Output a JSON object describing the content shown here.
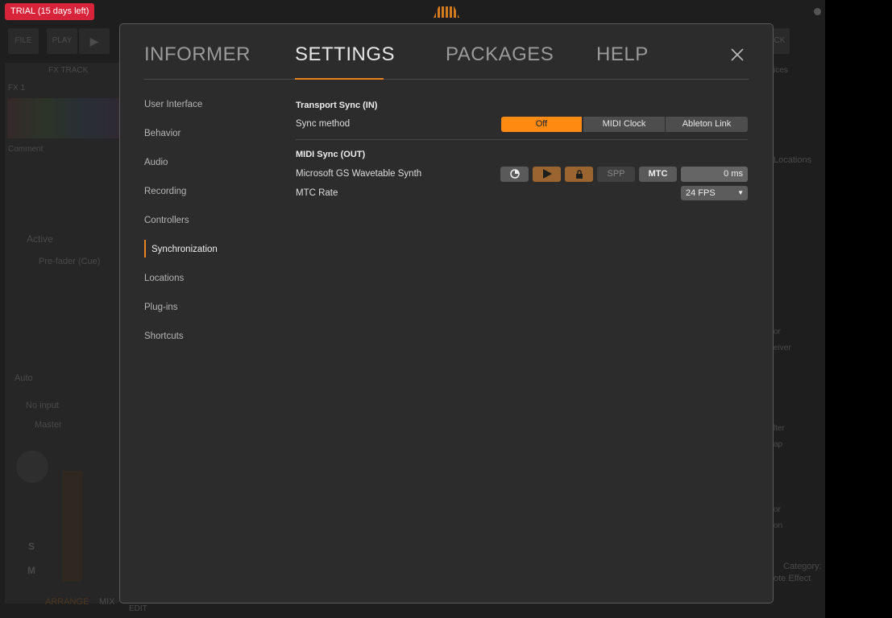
{
  "background": {
    "trial_badge": "TRIAL (15 days left)",
    "toolbar": {
      "file": "FILE",
      "play": "PLAY",
      "right_btn": "CK"
    },
    "inspector": {
      "title": "FX TRACK",
      "track_name": "FX 1",
      "comment_placeholder": "Comment",
      "active": "Active",
      "send": "Pre-fader (Cue)",
      "auto": "Auto",
      "input": "No input",
      "output": "Master",
      "solo": "S",
      "mute": "M"
    },
    "bottom_bar": {
      "arrange": "ARRANGE",
      "mix": "MIX",
      "edit": "EDIT"
    },
    "browser": {
      "devices": "ices",
      "locations": "Locations",
      "items": [
        "or",
        "eiver",
        "lter",
        "ap",
        "or",
        "on"
      ],
      "category": "Category:",
      "note_effect": "ote Effect"
    }
  },
  "dialog": {
    "tabs": [
      {
        "label": "INFORMER",
        "active": false
      },
      {
        "label": "SETTINGS",
        "active": true
      },
      {
        "label": "PACKAGES",
        "active": false
      },
      {
        "label": "HELP",
        "active": false
      }
    ],
    "close_icon": "close-x-icon",
    "sidebar": [
      {
        "label": "User Interface"
      },
      {
        "label": "Behavior"
      },
      {
        "label": "Audio"
      },
      {
        "label": "Recording"
      },
      {
        "label": "Controllers"
      },
      {
        "label": "Synchronization",
        "active": true
      },
      {
        "label": "Locations"
      },
      {
        "label": "Plug-ins"
      },
      {
        "label": "Shortcuts"
      }
    ],
    "content": {
      "transport_sync": {
        "heading": "Transport Sync (IN)",
        "sync_method_label": "Sync method",
        "options": [
          "Off",
          "MIDI Clock",
          "Ableton Link"
        ],
        "selected": "Off"
      },
      "midi_sync": {
        "heading": "MIDI Sync (OUT)",
        "device": "Microsoft GS Wavetable Synth",
        "buttons": {
          "clock_icon": "clock-icon",
          "play_icon": "play-icon",
          "lock_icon": "lock-icon",
          "spp": "SPP",
          "mtc": "MTC"
        },
        "offset": "0 ms",
        "mtc_rate_label": "MTC Rate",
        "mtc_rate": "24 FPS"
      }
    }
  },
  "colors": {
    "accent": "#ff8a12",
    "trial": "#d8243a",
    "dialog_bg": "#2c2c2c"
  }
}
